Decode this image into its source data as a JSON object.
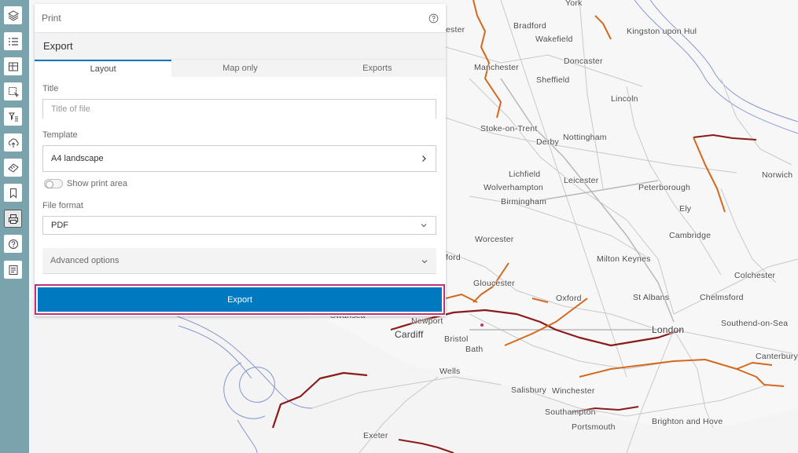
{
  "toolbar": {
    "items": [
      {
        "icon": "layers-icon"
      },
      {
        "icon": "legend-icon"
      },
      {
        "icon": "basemap-icon"
      },
      {
        "icon": "select-icon"
      },
      {
        "icon": "filter-icon"
      },
      {
        "icon": "upload-icon"
      },
      {
        "icon": "measure-icon"
      },
      {
        "icon": "bookmark-icon"
      },
      {
        "icon": "print-icon"
      },
      {
        "icon": "help-icon"
      },
      {
        "icon": "details-icon"
      }
    ],
    "active_index": 8
  },
  "panel": {
    "title": "Print",
    "subheader": "Export",
    "tabs": [
      {
        "label": "Layout",
        "active": true
      },
      {
        "label": "Map only",
        "active": false
      },
      {
        "label": "Exports",
        "active": false
      }
    ],
    "title_field": {
      "label": "Title",
      "placeholder": "Title of file",
      "value": ""
    },
    "template_field": {
      "label": "Template",
      "value": "A4 landscape"
    },
    "show_print_area": {
      "label": "Show print area",
      "checked": false
    },
    "file_format": {
      "label": "File format",
      "value": "PDF"
    },
    "advanced_label": "Advanced options",
    "export_label": "Export"
  },
  "map": {
    "places": [
      {
        "name": "York",
        "big": false
      },
      {
        "name": "Bradford",
        "big": false
      },
      {
        "name": "Wakefield",
        "big": false
      },
      {
        "name": "Kingston upon Hul",
        "big": false
      },
      {
        "name": "Doncaster",
        "big": false
      },
      {
        "name": "Manchester",
        "big": false
      },
      {
        "name": "Sheffield",
        "big": false
      },
      {
        "name": "Lincoln",
        "big": false
      },
      {
        "name": "Stoke-on-Trent",
        "big": false
      },
      {
        "name": "Derby",
        "big": false
      },
      {
        "name": "Nottingham",
        "big": false
      },
      {
        "name": "Norwich",
        "big": false
      },
      {
        "name": "Lichfield",
        "big": false
      },
      {
        "name": "Wolverhampton",
        "big": false
      },
      {
        "name": "Leicester",
        "big": false
      },
      {
        "name": "Peterborough",
        "big": false
      },
      {
        "name": "Birmingham",
        "big": false
      },
      {
        "name": "Ely",
        "big": false
      },
      {
        "name": "Worcester",
        "big": false
      },
      {
        "name": "Cambridge",
        "big": false
      },
      {
        "name": "Milton Keynes",
        "big": false
      },
      {
        "name": "Colchester",
        "big": false
      },
      {
        "name": "Gloucester",
        "big": false
      },
      {
        "name": "Oxford",
        "big": false
      },
      {
        "name": "St Albans",
        "big": false
      },
      {
        "name": "Chelmsford",
        "big": false
      },
      {
        "name": "Newport",
        "big": false
      },
      {
        "name": "London",
        "big": true
      },
      {
        "name": "Southend-on-Sea",
        "big": false
      },
      {
        "name": "Cardiff",
        "big": true
      },
      {
        "name": "Bristol",
        "big": false
      },
      {
        "name": "Bath",
        "big": false
      },
      {
        "name": "Canterbury",
        "big": false
      },
      {
        "name": "Wells",
        "big": false
      },
      {
        "name": "Salisbury",
        "big": false
      },
      {
        "name": "Winchester",
        "big": false
      },
      {
        "name": "Southampton",
        "big": false
      },
      {
        "name": "Portsmouth",
        "big": false
      },
      {
        "name": "Brighton and Hove",
        "big": false
      },
      {
        "name": "Exeter",
        "big": false
      },
      {
        "name": "Swansea",
        "big": false
      },
      {
        "name": "ford",
        "big": false
      },
      {
        "name": "ester",
        "big": false
      }
    ]
  },
  "colors": {
    "toolbar_bg": "#7aa3ad",
    "accent": "#0079c1",
    "highlight_border": "#c2307a",
    "trail_orange": "#d2691e",
    "trail_dark": "#8b1a1a",
    "coast": "#6a7ec8"
  }
}
